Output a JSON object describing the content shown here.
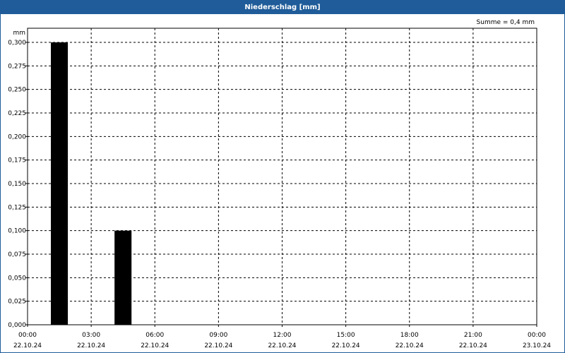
{
  "window": {
    "title": "Niederschlag [mm]"
  },
  "summary": "Summe = 0,4 mm",
  "chart_data": {
    "type": "bar",
    "title": "Niederschlag [mm]",
    "ylabel": "mm",
    "xlabel": "",
    "ylim": [
      0,
      0.3
    ],
    "xlim": [
      "22.10.24 00:00",
      "23.10.24 00:00"
    ],
    "grid": true,
    "y_ticks": [
      "0,000",
      "0,025",
      "0,050",
      "0,075",
      "0,100",
      "0,125",
      "0,150",
      "0,175",
      "0,200",
      "0,225",
      "0,250",
      "0,275",
      "0,300"
    ],
    "y_tick_values": [
      0,
      0.025,
      0.05,
      0.075,
      0.1,
      0.125,
      0.15,
      0.175,
      0.2,
      0.225,
      0.25,
      0.275,
      0.3
    ],
    "x_ticks": [
      {
        "time": "00:00",
        "date": "22.10.24"
      },
      {
        "time": "03:00",
        "date": "22.10.24"
      },
      {
        "time": "06:00",
        "date": "22.10.24"
      },
      {
        "time": "09:00",
        "date": "22.10.24"
      },
      {
        "time": "12:00",
        "date": "22.10.24"
      },
      {
        "time": "15:00",
        "date": "22.10.24"
      },
      {
        "time": "18:00",
        "date": "22.10.24"
      },
      {
        "time": "21:00",
        "date": "22.10.24"
      },
      {
        "time": "00:00",
        "date": "23.10.24"
      }
    ],
    "bars": [
      {
        "start": "22.10.24 01:00",
        "end": "22.10.24 02:00",
        "value": 0.3
      },
      {
        "start": "22.10.24 04:00",
        "end": "22.10.24 05:00",
        "value": 0.1
      }
    ],
    "bar_color": "#000000"
  }
}
